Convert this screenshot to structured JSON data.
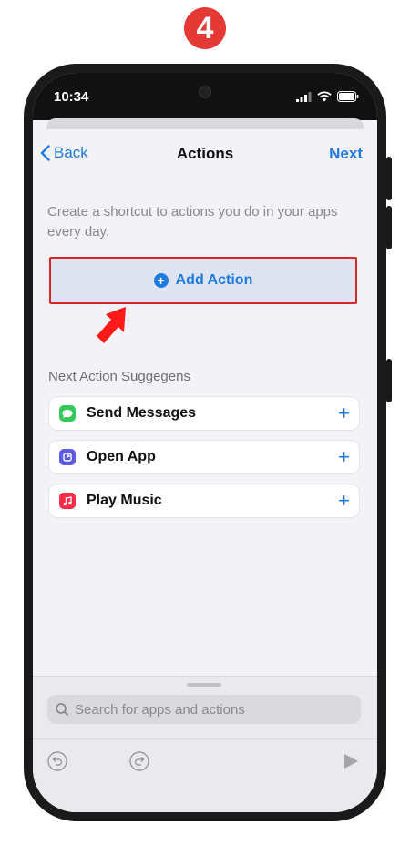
{
  "step_badge": "4",
  "status_bar": {
    "time": "10:34"
  },
  "nav": {
    "back_label": "Back",
    "title": "Actions",
    "next_label": "Next"
  },
  "intro_text": "Create a shortcut to actions you do in your apps every day.",
  "add_action": {
    "label": "Add Action"
  },
  "suggestions": {
    "heading": "Next Action Suggegens",
    "items": [
      {
        "label": "Send Messages",
        "icon": "messages-icon",
        "color": "#34c759"
      },
      {
        "label": "Open App",
        "icon": "open-app-icon",
        "color": "#5e5ce6"
      },
      {
        "label": "Play Music",
        "icon": "music-icon",
        "color": "#fa2d48"
      }
    ]
  },
  "search": {
    "placeholder": "Search for apps and actions"
  },
  "colors": {
    "accent": "#1f7ae0",
    "highlight_border": "#d62828",
    "badge": "#e53935"
  }
}
